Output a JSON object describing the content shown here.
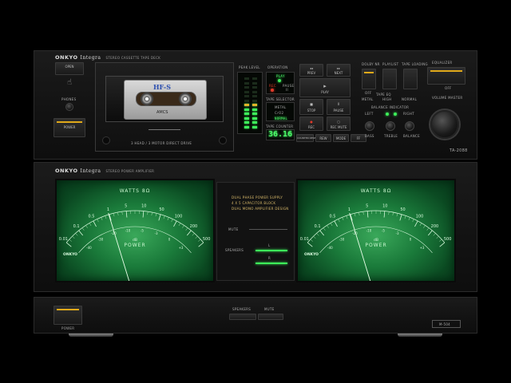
{
  "deck": {
    "brand": "ONKYO",
    "brand_series": "Integra",
    "subtitle": "STEREO CASSETTE TAPE DECK",
    "model": "TA-2088",
    "open_label": "OPEN",
    "phones_label": "PHONES",
    "power_label": "POWER",
    "cassette_label": "HF-S",
    "cassette_sub": "AMCS",
    "drive_text": "3 HEAD / 3 MOTOR DIRECT DRIVE",
    "peak_level_label": "PEAK LEVEL",
    "operation_label": "OPERATION",
    "play_label": "PLAY",
    "rec_label": "REC",
    "pause_label": "PAUSE",
    "tape_selector_label": "TAPE SELECTOR",
    "tape_options": [
      "METAL",
      "CrO2",
      "NORMAL"
    ],
    "tape_counter_label": "TAPE COUNTER",
    "counter_value": "36.16",
    "counter_reset_label": "COUNTER RESET",
    "rew_label": "REW",
    "mode_label": "MODE",
    "ff_label": "FF",
    "transport": {
      "prev": "PREV",
      "next": "NEXT",
      "play": "PLAY",
      "stop": "STOP",
      "pause": "PAUSE",
      "rec": "REC",
      "rec_mute": "REC MUTE"
    },
    "right_controls": {
      "dolby": "DOLBY NR",
      "on": "ON",
      "off": "OFF",
      "playlist": "PLAYLIST",
      "tape_loading": "TAPE LOADING",
      "equalizer": "EQUALIZER",
      "tape_eq_label": "TAPE EQ",
      "eq_modes": [
        "METAL",
        "HIGH",
        "NORMAL"
      ],
      "balance_indicator": "BALANCE INDICATOR",
      "left": "LEFT",
      "right": "RIGHT",
      "bass": "BASS",
      "treble": "TREBLE",
      "balance": "BALANCE",
      "volume": "VOLUME MASTER"
    }
  },
  "amp": {
    "brand": "ONKYO",
    "brand_series": "Integra",
    "subtitle": "STEREO POWER AMPLIFIER",
    "model": "M-504",
    "meters": [
      {
        "title": "WATTS 8Ω",
        "scale_top": [
          "0.01",
          "0.1",
          "0.5",
          "1",
          "5",
          "10",
          "50",
          "100",
          "200",
          "500"
        ],
        "scale_bottom": [
          "-40",
          "-30",
          "-20",
          "-10",
          "-5",
          "-3",
          "0",
          "+3"
        ],
        "db_label": "dB",
        "power_label": "POWER",
        "brand": "ONKYO",
        "needle_value": 0.33
      },
      {
        "title": "WATTS 8Ω",
        "scale_top": [
          "0.01",
          "0.1",
          "0.5",
          "1",
          "5",
          "10",
          "50",
          "100",
          "200",
          "500"
        ],
        "scale_bottom": [
          "-40",
          "-30",
          "-20",
          "-10",
          "-5",
          "-3",
          "0",
          "+3"
        ],
        "db_label": "dB",
        "power_label": "POWER",
        "brand": "ONKYO",
        "needle_value": 0.33
      }
    ],
    "center_text": [
      "DUAL PHASE POWER SUPPLY",
      "4 X 5 CAPACITOR BLOCK",
      "DUAL MONO AMPLIFIER DESIGN"
    ],
    "mute_label": "MUTE",
    "speakers_label": "SPEAKERS",
    "speaker_a": "L",
    "speaker_b": "R"
  },
  "bottom": {
    "power_label": "POWER",
    "speakers_label": "SPEAKERS",
    "mute_label": "MUTE",
    "model": "M-504"
  },
  "colors": {
    "accent_yellow": "#e0a91a",
    "meter_green": "#1a7a3a",
    "display_green": "#4cff6a"
  }
}
